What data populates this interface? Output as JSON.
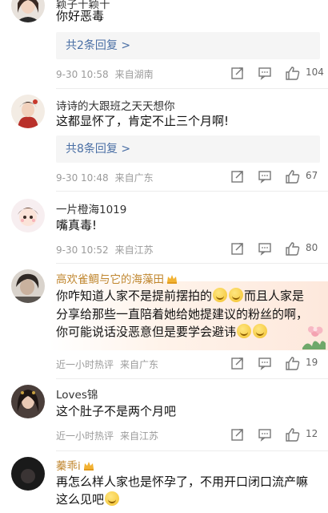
{
  "comments": [
    {
      "name": "颖子十颖十",
      "text": "你好恶毒",
      "replies": "共2条回复 >",
      "time": "9-30 10:58",
      "source": "来自湖南",
      "likes": "104"
    },
    {
      "name": "诗诗的大跟班之天天想你",
      "text": "这都显怀了，肯定不止三个月啊!",
      "replies": "共8条回复 >",
      "time": "9-30 10:48",
      "source": "来自广东",
      "likes": "67"
    },
    {
      "name": "一片橙海1019",
      "text": "嘴真毒!",
      "time": "9-30 10:52",
      "source": "来自江苏",
      "likes": "80"
    },
    {
      "name": "高欢雀鲷与它的海藻田",
      "line1": "你咋知道人家不是提前摆拍的",
      "line1b": "而且人家是",
      "line2": "分享给那些一直陪着她给她提建议的粉丝的啊，",
      "line3": "你可能说话没恶意但是要学会避讳",
      "time": "近一小时热评",
      "source": "来自广东",
      "likes": "19"
    },
    {
      "name": "Loves锦",
      "text": "这个肚子不是两个月吧",
      "time": "近一小时热评",
      "source": "来自江苏",
      "likes": "12"
    },
    {
      "name": "蓁乖i",
      "line1": "再怎么样人家也是怀孕了，不用开口闭口流产嘛",
      "line2": "这么见吧"
    }
  ],
  "colors": {
    "link": "#4a6fa5",
    "gold_name": "#c0862e",
    "meta": "#9b9b9b"
  }
}
